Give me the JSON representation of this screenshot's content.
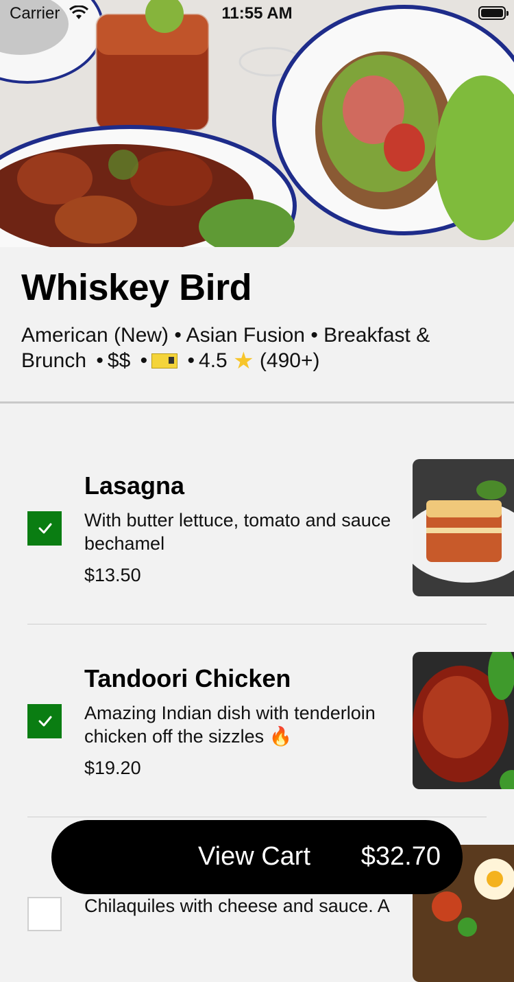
{
  "status_bar": {
    "carrier": "Carrier",
    "time": "11:55 AM"
  },
  "restaurant": {
    "name": "Whiskey Bird",
    "cuisines": "American (New) • Asian Fusion • Breakfast & Brunch",
    "price": "$$",
    "rating": "4.5",
    "reviews": "(490+)",
    "separator": "•"
  },
  "menu": {
    "items": [
      {
        "name": "Lasagna",
        "description": "With butter lettuce, tomato and sauce bechamel",
        "price": "$13.50",
        "checked": true
      },
      {
        "name": "Tandoori Chicken",
        "description": "Amazing Indian dish with tenderloin chicken off the sizzles 🔥",
        "price": "$19.20",
        "checked": true
      },
      {
        "name": "",
        "description": "Chilaquiles with cheese and sauce. A",
        "price": "",
        "checked": false
      }
    ]
  },
  "cart": {
    "label": "View Cart",
    "total": "$32.70"
  },
  "colors": {
    "checkbox_checked": "#0a7d12",
    "cart_bg": "#000000",
    "background": "#f2f2f2"
  }
}
